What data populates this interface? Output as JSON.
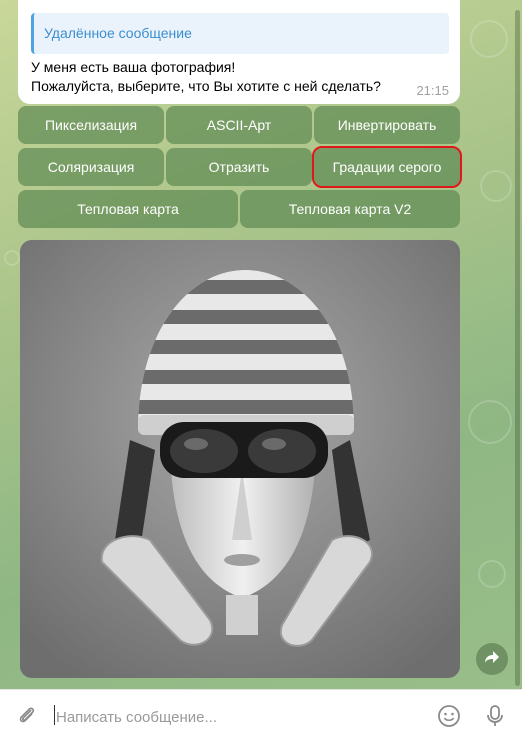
{
  "message": {
    "reply_title": "Удалённое сообщение",
    "text": "У меня есть ваша фотография!\nПожалуйста, выберите, что Вы хотите с ней сделать?",
    "time": "21:15"
  },
  "keyboard": {
    "row1": [
      "Пикселизация",
      "ASCII-Арт",
      "Инвертировать"
    ],
    "row2": [
      "Соляризация",
      "Отразить",
      "Градации серого"
    ],
    "row3": [
      "Тепловая карта",
      "Тепловая карта V2"
    ],
    "highlighted": "Градации серого"
  },
  "input": {
    "placeholder": "Написать сообщение..."
  },
  "icons": {
    "attach": "paperclip-icon",
    "emoji": "smile-icon",
    "voice": "microphone-icon",
    "share": "forward-arrow-icon"
  },
  "colors": {
    "button_bg": "#608a54",
    "highlight": "#e01818",
    "reply_accent": "#4fa3e0"
  }
}
